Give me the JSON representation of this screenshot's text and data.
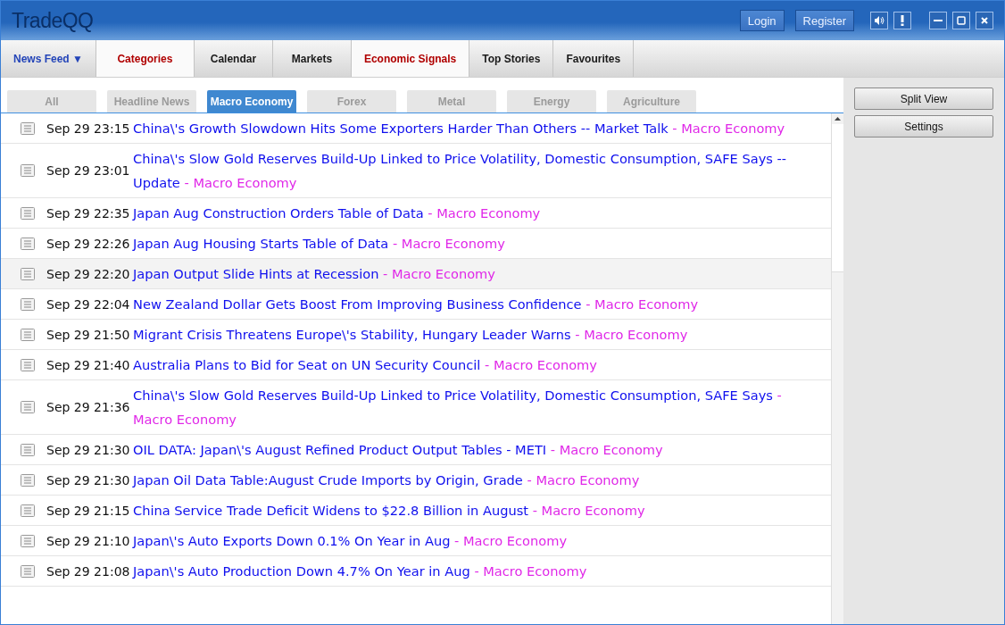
{
  "app": {
    "logo": "TradeQQ",
    "buttons": [
      "Login",
      "Register"
    ]
  },
  "nav_tabs": [
    {
      "label": "News Feed ▼",
      "selected": false,
      "kind": "menu"
    },
    {
      "label": "Categories",
      "selected": true,
      "kind": "tab"
    },
    {
      "label": "Calendar",
      "selected": false,
      "kind": "tab"
    },
    {
      "label": "Markets",
      "selected": false,
      "kind": "tab"
    },
    {
      "label": "Economic Signals",
      "selected": true,
      "kind": "tab"
    },
    {
      "label": "Top Stories",
      "selected": false,
      "kind": "tab"
    },
    {
      "label": "Favourites",
      "selected": false,
      "kind": "tab"
    }
  ],
  "filter_tabs": [
    {
      "label": "All",
      "selected": false
    },
    {
      "label": "Headline News",
      "selected": false
    },
    {
      "label": "Macro Economy",
      "selected": true
    },
    {
      "label": "Forex",
      "selected": false
    },
    {
      "label": "Metal",
      "selected": false
    },
    {
      "label": "Energy",
      "selected": false
    },
    {
      "label": "Agriculture",
      "selected": false
    }
  ],
  "news": [
    {
      "time": "Sep 29 23:15",
      "title": "China\\'s Growth Slowdown Hits Some Exporters Harder Than Others -- Market Talk",
      "category": "- Macro Economy",
      "selected": false
    },
    {
      "time": "Sep 29 23:01",
      "title": "China\\'s Slow Gold Reserves Build-Up Linked to Price Volatility, Domestic Consumption, SAFE Says -- Update",
      "category": "- Macro Economy",
      "selected": false
    },
    {
      "time": "Sep 29 22:35",
      "title": "Japan Aug Construction Orders Table of Data",
      "category": "- Macro Economy",
      "selected": false
    },
    {
      "time": "Sep 29 22:26",
      "title": "Japan Aug Housing Starts Table of Data",
      "category": "- Macro Economy",
      "selected": false
    },
    {
      "time": "Sep 29 22:20",
      "title": "Japan Output Slide Hints at Recession",
      "category": "- Macro Economy",
      "selected": true
    },
    {
      "time": "Sep 29 22:04",
      "title": "New Zealand Dollar Gets Boost From Improving Business Confidence",
      "category": "- Macro Economy",
      "selected": false
    },
    {
      "time": "Sep 29 21:50",
      "title": "Migrant Crisis Threatens Europe\\'s Stability, Hungary Leader Warns",
      "category": "- Macro Economy",
      "selected": false
    },
    {
      "time": "Sep 29 21:40",
      "title": "Australia Plans to Bid for Seat on UN Security Council",
      "category": "- Macro Economy",
      "selected": false
    },
    {
      "time": "Sep 29 21:36",
      "title": "China\\'s Slow Gold Reserves Build-Up Linked to Price Volatility, Domestic Consumption, SAFE Says",
      "category": "- Macro Economy",
      "selected": false
    },
    {
      "time": "Sep 29 21:30",
      "title": "OIL DATA: Japan\\'s August Refined Product Output Tables - METI",
      "category": "- Macro Economy",
      "selected": false
    },
    {
      "time": "Sep 29 21:30",
      "title": "Japan Oil Data Table:August Crude Imports by Origin, Grade",
      "category": "- Macro Economy",
      "selected": false
    },
    {
      "time": "Sep 29 21:15",
      "title": "China Service Trade Deficit Widens to $22.8 Billion in August",
      "category": "- Macro Economy",
      "selected": false
    },
    {
      "time": "Sep 29 21:10",
      "title": "Japan\\'s Auto Exports Down 0.1% On Year in Aug",
      "category": "- Macro Economy",
      "selected": false
    },
    {
      "time": "Sep 29 21:08",
      "title": "Japan\\'s Auto Production Down 4.7% On Year in Aug",
      "category": "- Macro Economy",
      "selected": false
    }
  ],
  "side_buttons": [
    "Split View",
    "Settings"
  ]
}
